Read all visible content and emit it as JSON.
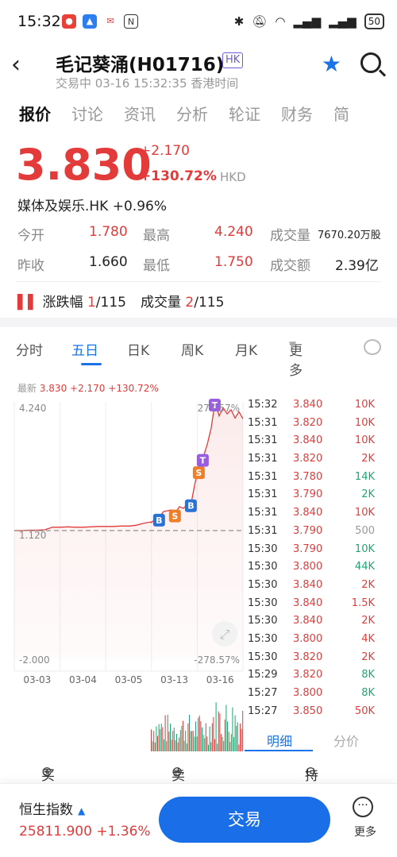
{
  "status": {
    "time": "15:32",
    "battery": "50",
    "apps": [
      "weibo-icon",
      "app-icon",
      "mail-icon",
      "nfc-icon"
    ]
  },
  "header": {
    "title": "毛记葵涌(H01716)",
    "market_tag": "HK",
    "subtitle": "交易中 03-16 15:32:35 香港时间"
  },
  "tabs": [
    "报价",
    "讨论",
    "资讯",
    "分析",
    "轮证",
    "财务",
    "简"
  ],
  "quote": {
    "price": "3.830",
    "change": "+2.170",
    "change_pct": "+130.72%",
    "currency": "HKD",
    "sector": "媒体及娱乐.HK +0.96%",
    "stats": [
      {
        "label": "今开",
        "value": "1.780",
        "label2": "最高",
        "value2": "4.240",
        "label3": "成交量",
        "value3": "7670.20万股"
      },
      {
        "label": "昨收",
        "value": "1.660",
        "label2": "最低",
        "value2": "1.750",
        "label3": "成交额",
        "value3": "2.39亿"
      }
    ],
    "rank_label": "涨跌幅",
    "rank_value": "1",
    "rank_total": "/115",
    "vol_rank_label": "成交量",
    "vol_rank_value": "2",
    "vol_rank_total": "/115"
  },
  "chart_tabs": [
    "分时",
    "五日",
    "日K",
    "周K",
    "月K",
    "更多"
  ],
  "latest": {
    "label": "最新",
    "price": "3.830",
    "change": "+2.170",
    "pct": "+130.72%"
  },
  "chart_data": {
    "type": "line",
    "y_top_label": "4.240",
    "y_mid_label": "1.120",
    "y_bottom_label": "-2.000",
    "pct_top_label": "277.57%",
    "pct_bottom_label": "-278.57%",
    "x_labels": [
      "03-03",
      "03-04",
      "03-05",
      "03-13",
      "03-16"
    ],
    "ylim": [
      -2.0,
      4.24
    ],
    "reference": 1.12,
    "series": [
      {
        "values": [
          1.12,
          1.12,
          1.13,
          1.13,
          1.14,
          1.2,
          1.2,
          1.21,
          1.2,
          1.2,
          1.21,
          1.22,
          1.22,
          1.22,
          1.23,
          1.23,
          1.25,
          1.3,
          1.33,
          1.32,
          1.4,
          1.45,
          1.58,
          1.6,
          1.62,
          1.55,
          1.7,
          1.66,
          1.75,
          1.8,
          2.3,
          2.6,
          2.9,
          3.2,
          3.6,
          4.24,
          3.9,
          4.1,
          3.95,
          4.05,
          3.85,
          4.0,
          3.83
        ]
      }
    ],
    "markers": [
      "B",
      "S",
      "B",
      "S",
      "T",
      "T"
    ]
  },
  "trades": [
    {
      "time": "15:32",
      "price": "3.840",
      "vol": "10K",
      "color": "red"
    },
    {
      "time": "15:31",
      "price": "3.820",
      "vol": "10K",
      "color": "red"
    },
    {
      "time": "15:31",
      "price": "3.840",
      "vol": "10K",
      "color": "red"
    },
    {
      "time": "15:31",
      "price": "3.820",
      "vol": "2K",
      "color": "red"
    },
    {
      "time": "15:31",
      "price": "3.780",
      "vol": "14K",
      "color": "green"
    },
    {
      "time": "15:31",
      "price": "3.790",
      "vol": "2K",
      "color": "green"
    },
    {
      "time": "15:31",
      "price": "3.840",
      "vol": "10K",
      "color": "red"
    },
    {
      "time": "15:31",
      "price": "3.790",
      "vol": "500",
      "color": "gray"
    },
    {
      "time": "15:30",
      "price": "3.790",
      "vol": "10K",
      "color": "green"
    },
    {
      "time": "15:30",
      "price": "3.800",
      "vol": "44K",
      "color": "green"
    },
    {
      "time": "15:30",
      "price": "3.840",
      "vol": "2K",
      "color": "red"
    },
    {
      "time": "15:30",
      "price": "3.840",
      "vol": "1.5K",
      "color": "red"
    },
    {
      "time": "15:30",
      "price": "3.840",
      "vol": "2K",
      "color": "red"
    },
    {
      "time": "15:30",
      "price": "3.800",
      "vol": "4K",
      "color": "red"
    },
    {
      "time": "15:30",
      "price": "3.820",
      "vol": "2K",
      "color": "red"
    },
    {
      "time": "15:29",
      "price": "3.820",
      "vol": "8K",
      "color": "green"
    },
    {
      "time": "15:27",
      "price": "3.800",
      "vol": "8K",
      "color": "green"
    },
    {
      "time": "15:27",
      "price": "3.850",
      "vol": "50K",
      "color": "red"
    }
  ],
  "subtabs": {
    "detail": "明细",
    "price_dist": "分价"
  },
  "actions": [
    "买入",
    "卖出",
    "持仓"
  ],
  "bottom": {
    "index_name": "恒生指数",
    "index_value": "25811.900 +1.36%",
    "trade_button": "交易",
    "more_label": "更多"
  },
  "colors": {
    "up": "#e33a3a",
    "down": "#1ea672",
    "accent": "#1a6fe8"
  }
}
